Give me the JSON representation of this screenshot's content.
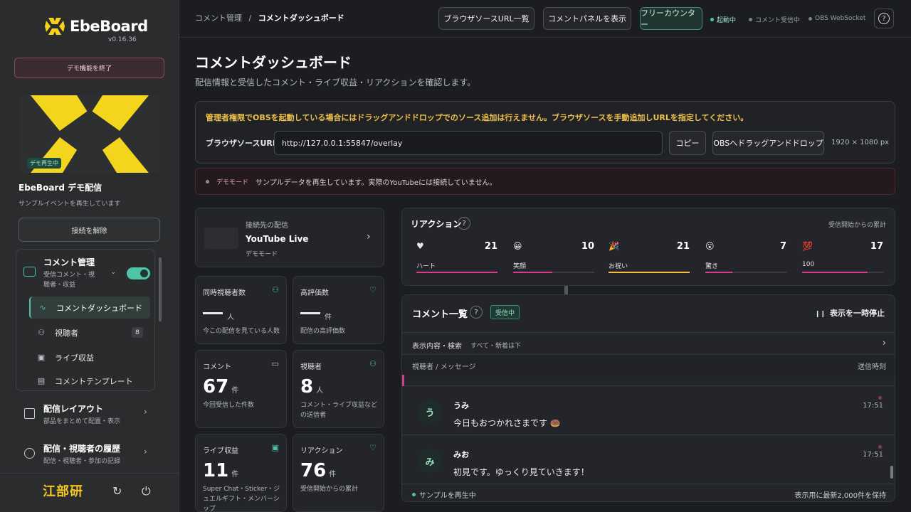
{
  "app": {
    "name": "EbeBoard",
    "version": "v0.16.36",
    "footer_brand": "江部研"
  },
  "sidebar": {
    "demo_end_label": "デモ機能を終了",
    "thumb_badge": "デモ再生中",
    "stream_title": "EbeBoard デモ配信",
    "stream_sub": "サンプルイベントを再生しています",
    "disconnect_label": "接続を解除",
    "group": {
      "title": "コメント管理",
      "subtitle": "受信コメント・視聴者・収益",
      "toggle_on": true,
      "items": [
        {
          "label": "コメントダッシュボード",
          "icon": "pulse-icon",
          "active": true
        },
        {
          "label": "視聴者",
          "icon": "users-icon",
          "badge": "8"
        },
        {
          "label": "ライブ収益",
          "icon": "gift-icon"
        },
        {
          "label": "コメントテンプレート",
          "icon": "template-icon"
        }
      ]
    },
    "items": [
      {
        "title": "配信レイアウト",
        "sub": "部品をまとめて配置・表示",
        "icon": "layout-icon"
      },
      {
        "title": "配信・視聴者の履歴",
        "sub": "配信・視聴者・参加の記録",
        "icon": "history-icon"
      }
    ]
  },
  "header": {
    "breadcrumb_root": "コメント管理",
    "breadcrumb_sep": "/",
    "breadcrumb_current": "コメントダッシュボード",
    "buttons": {
      "browser_sources": "ブラウザソースURL一覧",
      "comment_panel": "コメントパネルを表示",
      "free_counter": "フリーカウンター"
    },
    "status": [
      {
        "label": "起動中",
        "color": "#4fc3a5"
      },
      {
        "label": "コメント受信中",
        "color": "#7c8084"
      },
      {
        "label": "OBS WebSocket",
        "color": "#7c8084"
      }
    ],
    "help": "?"
  },
  "page": {
    "title": "コメントダッシュボード",
    "subtitle": "配信情報と受信したコメント・ライブ収益・リアクションを確認します。"
  },
  "obs": {
    "warning": "管理者権限でOBSを起動している場合にはドラッグアンドドロップでのソース追加は行えません。ブラウザソースを手動追加しURLを指定してください。",
    "url_label": "ブラウザソースURL",
    "url_value": "http://127.0.0.1:55847/overlay",
    "copy_label": "コピー",
    "drag_label": "OBSへドラッグアンドドロップ",
    "dimensions": "1920 × 1080 px"
  },
  "demo_banner": {
    "tag": "デモモード",
    "text": "サンプルデータを再生しています。実際のYouTubeには接続していません。"
  },
  "connection": {
    "label": "接続先の配信",
    "platform": "YouTube Live",
    "mode": "デモモード"
  },
  "stats": [
    {
      "label": "同時視聴者数",
      "icon": "users-icon",
      "value": "—",
      "unit": "人",
      "desc": "今この配信を見ている人数"
    },
    {
      "label": "高評価数",
      "icon": "heart-icon",
      "value": "—",
      "unit": "件",
      "desc": "配信の高評価数"
    },
    {
      "label": "コメント",
      "icon": "comment-icon",
      "value": "67",
      "unit": "件",
      "desc": "今回受信した件数"
    },
    {
      "label": "視聴者",
      "icon": "users-icon",
      "value": "8",
      "unit": "人",
      "desc": "コメント・ライブ収益などの送信者"
    },
    {
      "label": "ライブ収益",
      "icon": "gift-icon",
      "value": "11",
      "unit": "件",
      "desc": "Super Chat・Sticker・ジュエルギフト・メンバーシップ"
    },
    {
      "label": "リアクション",
      "icon": "heart-icon",
      "value": "76",
      "unit": "件",
      "desc": "受信開始からの累計"
    }
  ],
  "reactions": {
    "title": "リアクション",
    "help": "?",
    "note": "受信開始からの累計",
    "items": [
      {
        "emoji": "♥",
        "icon": "heart-icon",
        "label": "ハート",
        "count": "21",
        "fill": 1.0,
        "color": "#d43c8e"
      },
      {
        "emoji": "😀",
        "icon": "smile-icon",
        "label": "笑顔",
        "count": "10",
        "fill": 0.48,
        "color": "#d43c8e"
      },
      {
        "emoji": "🎉",
        "icon": "party-icon",
        "label": "お祝い",
        "count": "21",
        "fill": 1.0,
        "color": "#f0c23b"
      },
      {
        "emoji": "😮",
        "icon": "surprise-icon",
        "label": "驚き",
        "count": "7",
        "fill": 0.33,
        "color": "#d43c8e"
      },
      {
        "emoji": "💯",
        "icon": "hundred-icon",
        "label": "100",
        "count": "17",
        "fill": 0.81,
        "color": "#d43c8e"
      }
    ]
  },
  "comments": {
    "title": "コメント一覧",
    "help": "?",
    "live_badge": "受信中",
    "pause_label": "表示を一時停止",
    "filter_label": "表示内容・検索",
    "filter_value": "すべて・新着は下",
    "col_left": "視聴者 / メッセージ",
    "col_right": "送信時刻",
    "rows": [
      {
        "initial": "う",
        "name": "うみ",
        "message": "今日もおつかれさまです 🍩",
        "time": "17:51"
      },
      {
        "initial": "み",
        "name": "みお",
        "message": "初見です。ゆっくり見ていきます！",
        "time": "17:51"
      }
    ],
    "footer_left": "サンプルを再生中",
    "footer_right": "表示用に最新2,000件を保持"
  }
}
